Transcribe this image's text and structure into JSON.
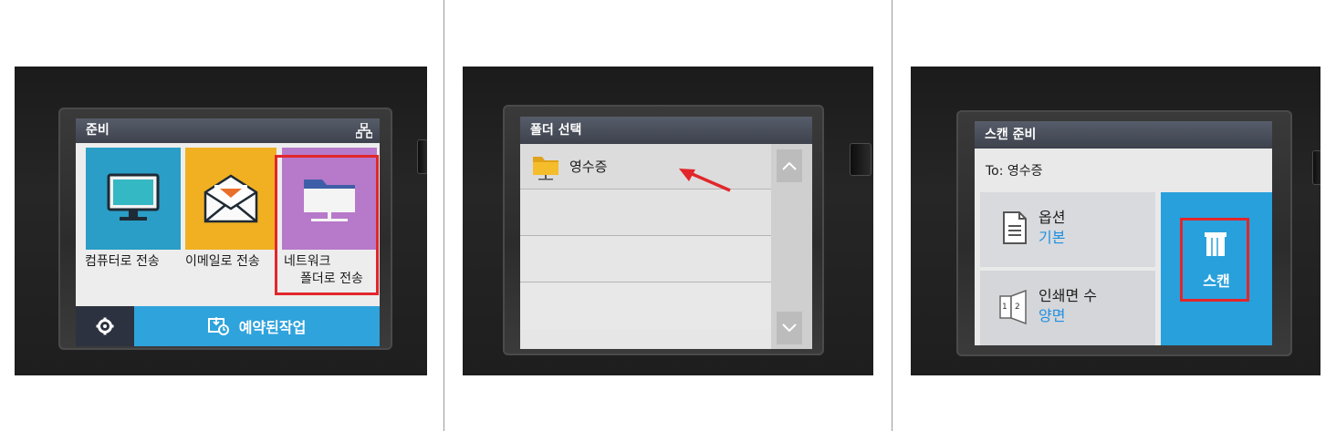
{
  "panels": [
    {
      "screen_title": "준비",
      "tiles": [
        {
          "label": "컴퓨터로 전송",
          "icon": "computer-monitor-icon",
          "color": "#2a9ec6"
        },
        {
          "label": "이메일로 전송",
          "icon": "email-envelope-icon",
          "color": "#f0b022"
        },
        {
          "label_line1": "네트워크",
          "label_line2": "폴더로 전송",
          "icon": "network-folder-icon",
          "color": "#b779c9",
          "highlighted": true
        }
      ],
      "settings_icon": "gear-icon",
      "scheduled_jobs_label": "예약된작업",
      "network_status_icon": "network-status-icon"
    },
    {
      "screen_title": "폴더 선택",
      "folders": [
        "영수증"
      ],
      "annotation": "red-arrow pointing to folder",
      "scroll_up_icon": "chevron-up-icon",
      "scroll_down_icon": "chevron-down-icon"
    },
    {
      "screen_title": "스캔 준비",
      "destination": "To: 영수증",
      "options": {
        "label": "옵션",
        "value": "기본"
      },
      "print_sides": {
        "label": "인쇄면 수",
        "value": "양면"
      },
      "scan_button_label": "스캔",
      "value_color": "#1f8fe0"
    }
  ],
  "highlight_color": "#e2262a"
}
